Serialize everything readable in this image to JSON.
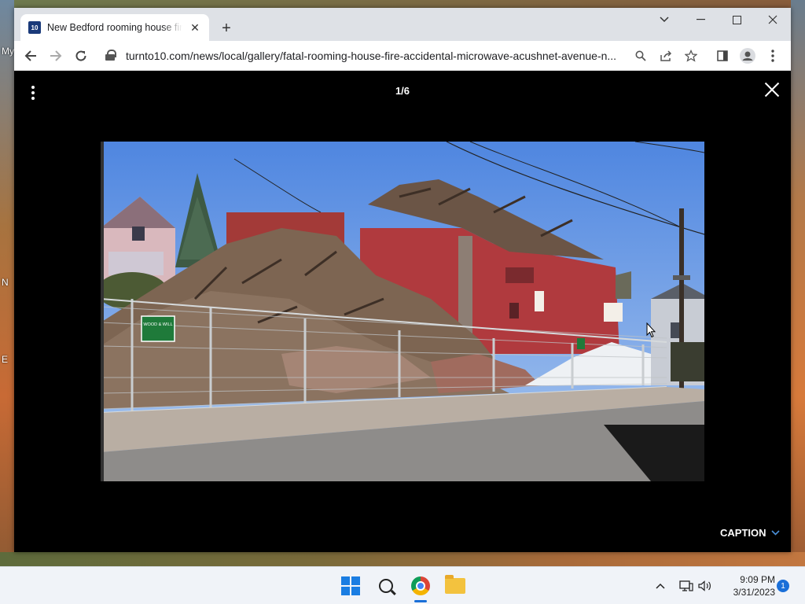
{
  "desktop": {
    "labels": [
      "My",
      "N",
      "E"
    ]
  },
  "browser": {
    "tab": {
      "favicon_text": "10",
      "title": "New Bedford rooming house fire"
    },
    "url": "turnto10.com/news/local/gallery/fatal-rooming-house-fire-accidental-microwave-acushnet-avenue-n..."
  },
  "gallery": {
    "counter": "1/6",
    "caption_label": "CAPTION",
    "photo": {
      "sign_text": "WOOD & WILL"
    }
  },
  "taskbar": {
    "time": "9:09 PM",
    "date": "3/31/2023",
    "notification_count": "1"
  },
  "colors": {
    "chrome_tabstrip": "#dee1e6",
    "gallery_bg": "#000000",
    "caption_chevron": "#4a8fd8",
    "accent_blue": "#1a6fd8"
  },
  "icons": {
    "window_controls": [
      "chevron-down-icon",
      "minimize-icon",
      "maximize-icon",
      "close-icon"
    ],
    "toolbar": [
      "back-icon",
      "forward-icon",
      "reload-icon",
      "lock-icon",
      "zoom-icon",
      "share-icon",
      "star-icon",
      "side-panel-icon",
      "profile-icon",
      "kebab-menu-icon"
    ]
  }
}
